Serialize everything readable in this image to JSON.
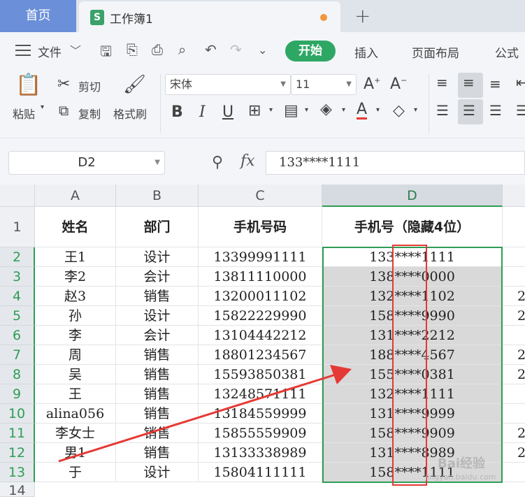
{
  "tabs": {
    "home": "首页",
    "doc_title": "工作簿1",
    "doc_logo": "S",
    "add": "+"
  },
  "menu": {
    "file": "文件",
    "start": "开始",
    "insert": "插入",
    "page_layout": "页面布局",
    "formula": "公式"
  },
  "ribbon": {
    "paste": "粘贴",
    "cut": "剪切",
    "copy": "复制",
    "format_painter": "格式刷",
    "font_name": "宋体",
    "font_size": "11",
    "bold": "B",
    "italic": "I",
    "underline": "U",
    "font_color_glyph": "A",
    "grow_font": "A",
    "shrink_font": "A"
  },
  "formula_bar": {
    "name_box": "D2",
    "fx": "fx",
    "value": "133****1111"
  },
  "columns": [
    "A",
    "B",
    "C",
    "D"
  ],
  "header_row": {
    "num": "1",
    "cells": [
      "姓名",
      "部门",
      "手机号码",
      "手机号（隐藏4位）"
    ]
  },
  "rows": [
    {
      "num": "2",
      "name": "王1",
      "dept": "设计",
      "phone": "13399991111",
      "masked": "133****1111"
    },
    {
      "num": "3",
      "name": "李2",
      "dept": "会计",
      "phone": "13811110000",
      "masked": "138****0000"
    },
    {
      "num": "4",
      "name": "赵3",
      "dept": "销售",
      "phone": "13200011102",
      "masked": "132****1102"
    },
    {
      "num": "5",
      "name": "孙",
      "dept": "设计",
      "phone": "15822229990",
      "masked": "158****9990"
    },
    {
      "num": "6",
      "name": "李",
      "dept": "会计",
      "phone": "13104442212",
      "masked": "131****2212"
    },
    {
      "num": "7",
      "name": "周",
      "dept": "销售",
      "phone": "18801234567",
      "masked": "188****4567"
    },
    {
      "num": "8",
      "name": "吴",
      "dept": "销售",
      "phone": "15593850381",
      "masked": "155****0381"
    },
    {
      "num": "9",
      "name": "王",
      "dept": "销售",
      "phone": "13248571111",
      "masked": "132****1111"
    },
    {
      "num": "10",
      "name": "alina056",
      "dept": "销售",
      "phone": "13184559999",
      "masked": "131****9999"
    },
    {
      "num": "11",
      "name": "李女士",
      "dept": "销售",
      "phone": "15855559909",
      "masked": "158****9909"
    },
    {
      "num": "12",
      "name": "男1",
      "dept": "销售",
      "phone": "13133338989",
      "masked": "131****8989"
    },
    {
      "num": "13",
      "name": "于",
      "dept": "设计",
      "phone": "15804111111",
      "masked": "158****1111"
    }
  ],
  "last_row_num": "14",
  "overflow_digits": [
    "2",
    "2",
    "2",
    "2",
    "2",
    "2"
  ],
  "watermark": {
    "brand": "Bai经验",
    "url": "jingyan.baidu.com"
  },
  "colors": {
    "accent_green": "#2ea765",
    "selection_border": "#2e9d55",
    "annotation_red": "#e53935"
  }
}
